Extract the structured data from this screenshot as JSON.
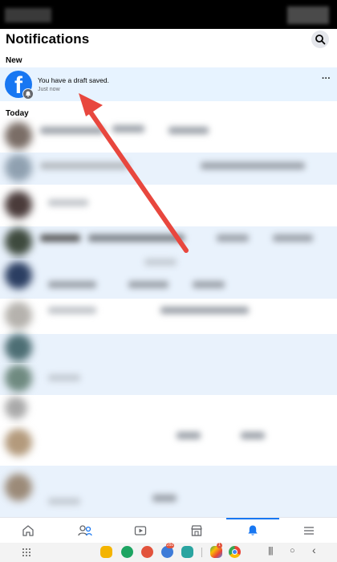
{
  "header": {
    "title": "Notifications"
  },
  "sections": {
    "new_label": "New",
    "today_label": "Today"
  },
  "new_notification": {
    "text": "You have a draft saved.",
    "time": "Just now",
    "more": "···"
  },
  "bottom_nav": {
    "items": [
      "home-icon",
      "friends-icon",
      "watch-icon",
      "marketplace-icon",
      "notifications-icon",
      "menu-icon"
    ],
    "active_index": 4,
    "active_color": "#1877f2"
  },
  "system_bar": {
    "apps": [
      "app-drawer-icon",
      "files-icon",
      "whatsapp-icon",
      "contacts-icon",
      "messages-icon",
      "calendar-icon",
      "play-store-icon",
      "chrome-icon"
    ],
    "messages_badge": "292",
    "play_badge": "1",
    "recent": "|||",
    "home": "○",
    "back": "‹"
  },
  "colors": {
    "accent": "#1877f2",
    "unread_bg": "#e7f3ff",
    "arrow": "#e8473e"
  }
}
